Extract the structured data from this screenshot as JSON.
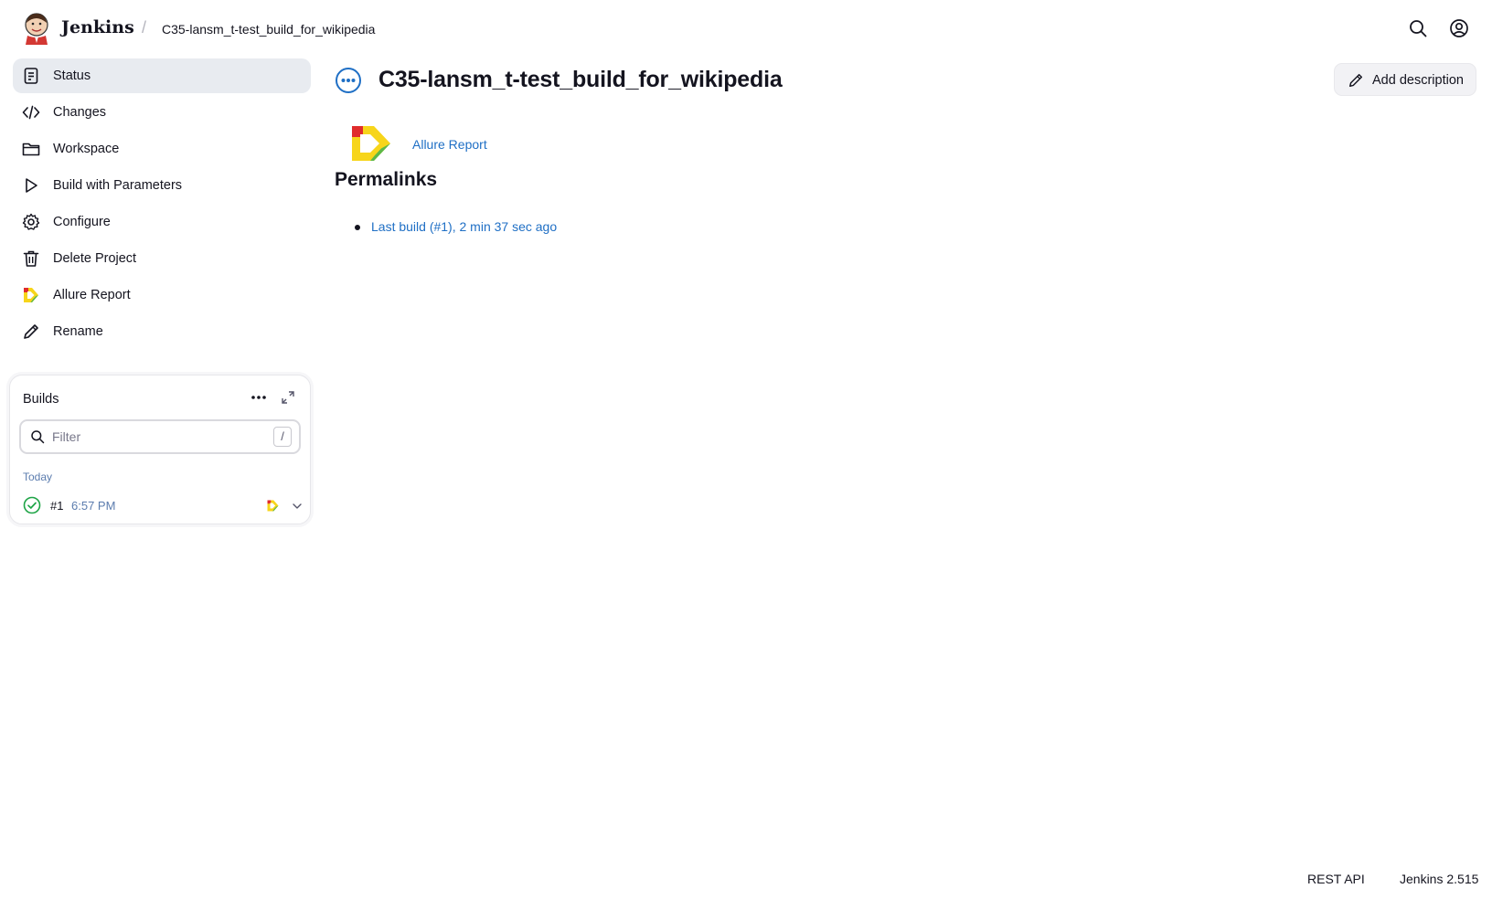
{
  "header": {
    "brand": "Jenkins",
    "breadcrumb_separator": "/",
    "breadcrumb": "C35-lansm_t-test_build_for_wikipedia",
    "icons": [
      "search-icon",
      "user-icon"
    ]
  },
  "sidebar": {
    "items": [
      {
        "label": "Status",
        "icon": "status-icon",
        "active": true
      },
      {
        "label": "Changes",
        "icon": "code-icon"
      },
      {
        "label": "Workspace",
        "icon": "folder-icon"
      },
      {
        "label": "Build with Parameters",
        "icon": "play-icon"
      },
      {
        "label": "Configure",
        "icon": "gear-icon"
      },
      {
        "label": "Delete Project",
        "icon": "trash-icon"
      },
      {
        "label": "Allure Report",
        "icon": "allure-icon"
      },
      {
        "label": "Rename",
        "icon": "pencil-icon"
      }
    ]
  },
  "builds": {
    "title": "Builds",
    "filter_placeholder": "Filter",
    "shortcut": "/",
    "group_label": "Today",
    "rows": [
      {
        "number": "#1",
        "time": "6:57 PM",
        "status": "success"
      }
    ]
  },
  "main": {
    "title": "C35-lansm_t-test_build_for_wikipedia",
    "add_description": "Add description",
    "allure_link": "Allure Report",
    "permalinks_heading": "Permalinks",
    "permalinks": [
      "Last build (#1), 2 min 37 sec ago"
    ]
  },
  "footer": {
    "rest_api": "REST API",
    "version": "Jenkins 2.515"
  },
  "colors": {
    "accent": "#1f6fc5",
    "active_bg": "#e8ebf0",
    "success": "#1ea446",
    "allure_red": "#e02c2c",
    "allure_yellow": "#f7d51a",
    "allure_green": "#5cb848"
  }
}
